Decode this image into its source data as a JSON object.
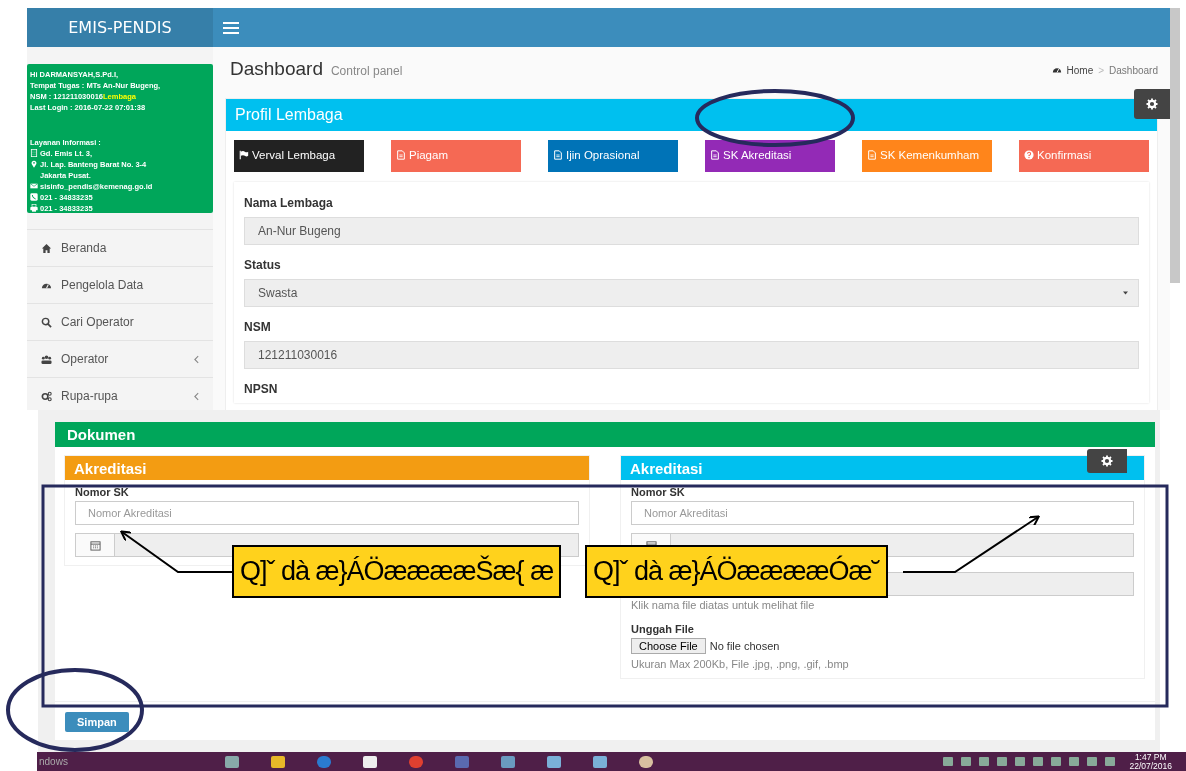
{
  "header": {
    "brand": "EMIS-PENDIS"
  },
  "user_info": {
    "greeting": "Hi DARMANSYAH,S.Pd.I,",
    "assignment": "Tempat Tugas : MTs An-Nur Bugeng,",
    "nsm": "NSM : 121211030016",
    "nsm_link": "Lembaga",
    "last_login": "Last Login : 2016-07-22 07:01:38"
  },
  "service_info": {
    "title": "Layanan Informasi :",
    "items": [
      {
        "kind": "building",
        "text": "Gd. Emis Lt. 3,"
      },
      {
        "kind": "pin",
        "text": "Jl. Lap. Banteng Barat No. 3-4 Jakarta Pusat."
      },
      {
        "kind": "mail",
        "text": "sisinfo_pendis@kemenag.go.id"
      },
      {
        "kind": "phone",
        "text": "021 - 34833235"
      },
      {
        "kind": "fax",
        "text": "021 - 34833235"
      }
    ]
  },
  "sidebar": {
    "items": [
      {
        "label": "Beranda",
        "has_submenu": false
      },
      {
        "label": "Pengelola Data",
        "has_submenu": false
      },
      {
        "label": "Cari Operator",
        "has_submenu": false
      },
      {
        "label": "Operator",
        "has_submenu": true
      },
      {
        "label": "Rupa-rupa",
        "has_submenu": true
      }
    ]
  },
  "page_header": {
    "title": "Dashboard",
    "subtitle": "Control panel",
    "breadcrumb": [
      {
        "kind": "home",
        "label": "Home"
      },
      {
        "kind": "page",
        "label": "Dashboard"
      }
    ],
    "separator": ">"
  },
  "profile_panel": {
    "title": "Profil Lembaga",
    "buttons": [
      {
        "label": "Verval Lembaga",
        "color": "#222222"
      },
      {
        "label": "Piagam",
        "color": "#f56954"
      },
      {
        "label": "Ijin Oprasional",
        "color": "#0073b7"
      },
      {
        "label": "SK Akreditasi",
        "color": "#932ab6"
      },
      {
        "label": "SK Kemenkumham",
        "color": "#ff851b"
      },
      {
        "label": "Konfirmasi",
        "color": "#f56954"
      }
    ],
    "fields": [
      {
        "kind": "text",
        "label": "Nama Lembaga",
        "value": "An-Nur Bugeng"
      },
      {
        "kind": "select",
        "label": "Status",
        "value": "Swasta"
      },
      {
        "kind": "text",
        "label": "NSM",
        "value": "121211030016"
      },
      {
        "kind": "heading",
        "label": "NPSN"
      }
    ]
  },
  "documents_panel": {
    "title": "Dokumen",
    "panels": [
      {
        "title": "Akreditasi",
        "color": "#f39c12",
        "label": "Nomor SK",
        "placeholder": "Nomor Akreditasi"
      },
      {
        "title": "Akreditasi",
        "color": "#00c0ef",
        "label": "Nomor SK",
        "placeholder": "Nomor Akreditasi",
        "upload": {
          "help": "Klik nama file diatas untuk melihat file",
          "label": "Unggah File",
          "button": "Choose File",
          "status": "No file chosen",
          "hint": "Ukuran Max 200Kb, File .jpg, .png, .gif, .bmp"
        }
      }
    ],
    "submit": "Simpan"
  },
  "callouts": [
    {
      "text": "Q]ˇ dà æ}ÁÖææææŠæ{ æ"
    },
    {
      "text": "Q]ˇ dà æ}ÁÖææææÓæ˘"
    }
  ],
  "taskbar": {
    "watermark": "ndows",
    "time": "1:47 PM",
    "date": "22/07/2016"
  }
}
